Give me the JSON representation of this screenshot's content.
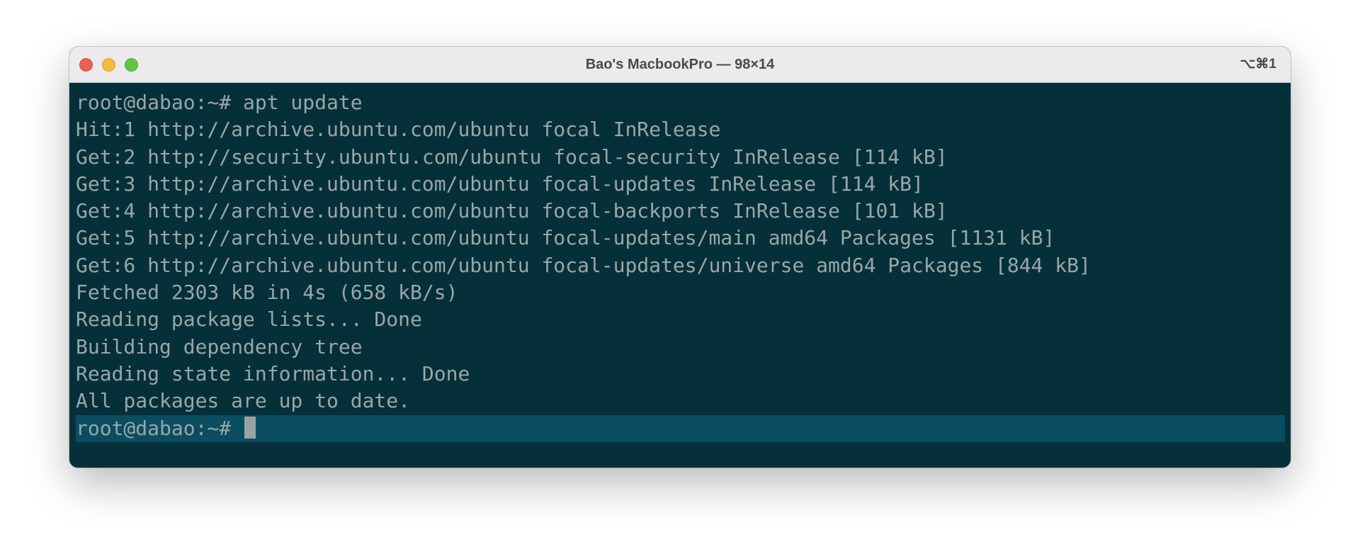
{
  "window": {
    "title": "Bao's MacbookPro — 98×14",
    "shortcut": "⌥⌘1"
  },
  "terminal": {
    "lines": [
      "root@dabao:~# apt update",
      "Hit:1 http://archive.ubuntu.com/ubuntu focal InRelease",
      "Get:2 http://security.ubuntu.com/ubuntu focal-security InRelease [114 kB]",
      "Get:3 http://archive.ubuntu.com/ubuntu focal-updates InRelease [114 kB]",
      "Get:4 http://archive.ubuntu.com/ubuntu focal-backports InRelease [101 kB]",
      "Get:5 http://archive.ubuntu.com/ubuntu focal-updates/main amd64 Packages [1131 kB]",
      "Get:6 http://archive.ubuntu.com/ubuntu focal-updates/universe amd64 Packages [844 kB]",
      "Fetched 2303 kB in 4s (658 kB/s)",
      "Reading package lists... Done",
      "Building dependency tree",
      "Reading state information... Done",
      "All packages are up to date."
    ],
    "prompt": "root@dabao:~# "
  },
  "colors": {
    "background": "#05303a",
    "text": "#9aa6a6",
    "current_line": "#0a4d61",
    "cursor": "#98a4a4",
    "titlebar": "#eceaec"
  }
}
